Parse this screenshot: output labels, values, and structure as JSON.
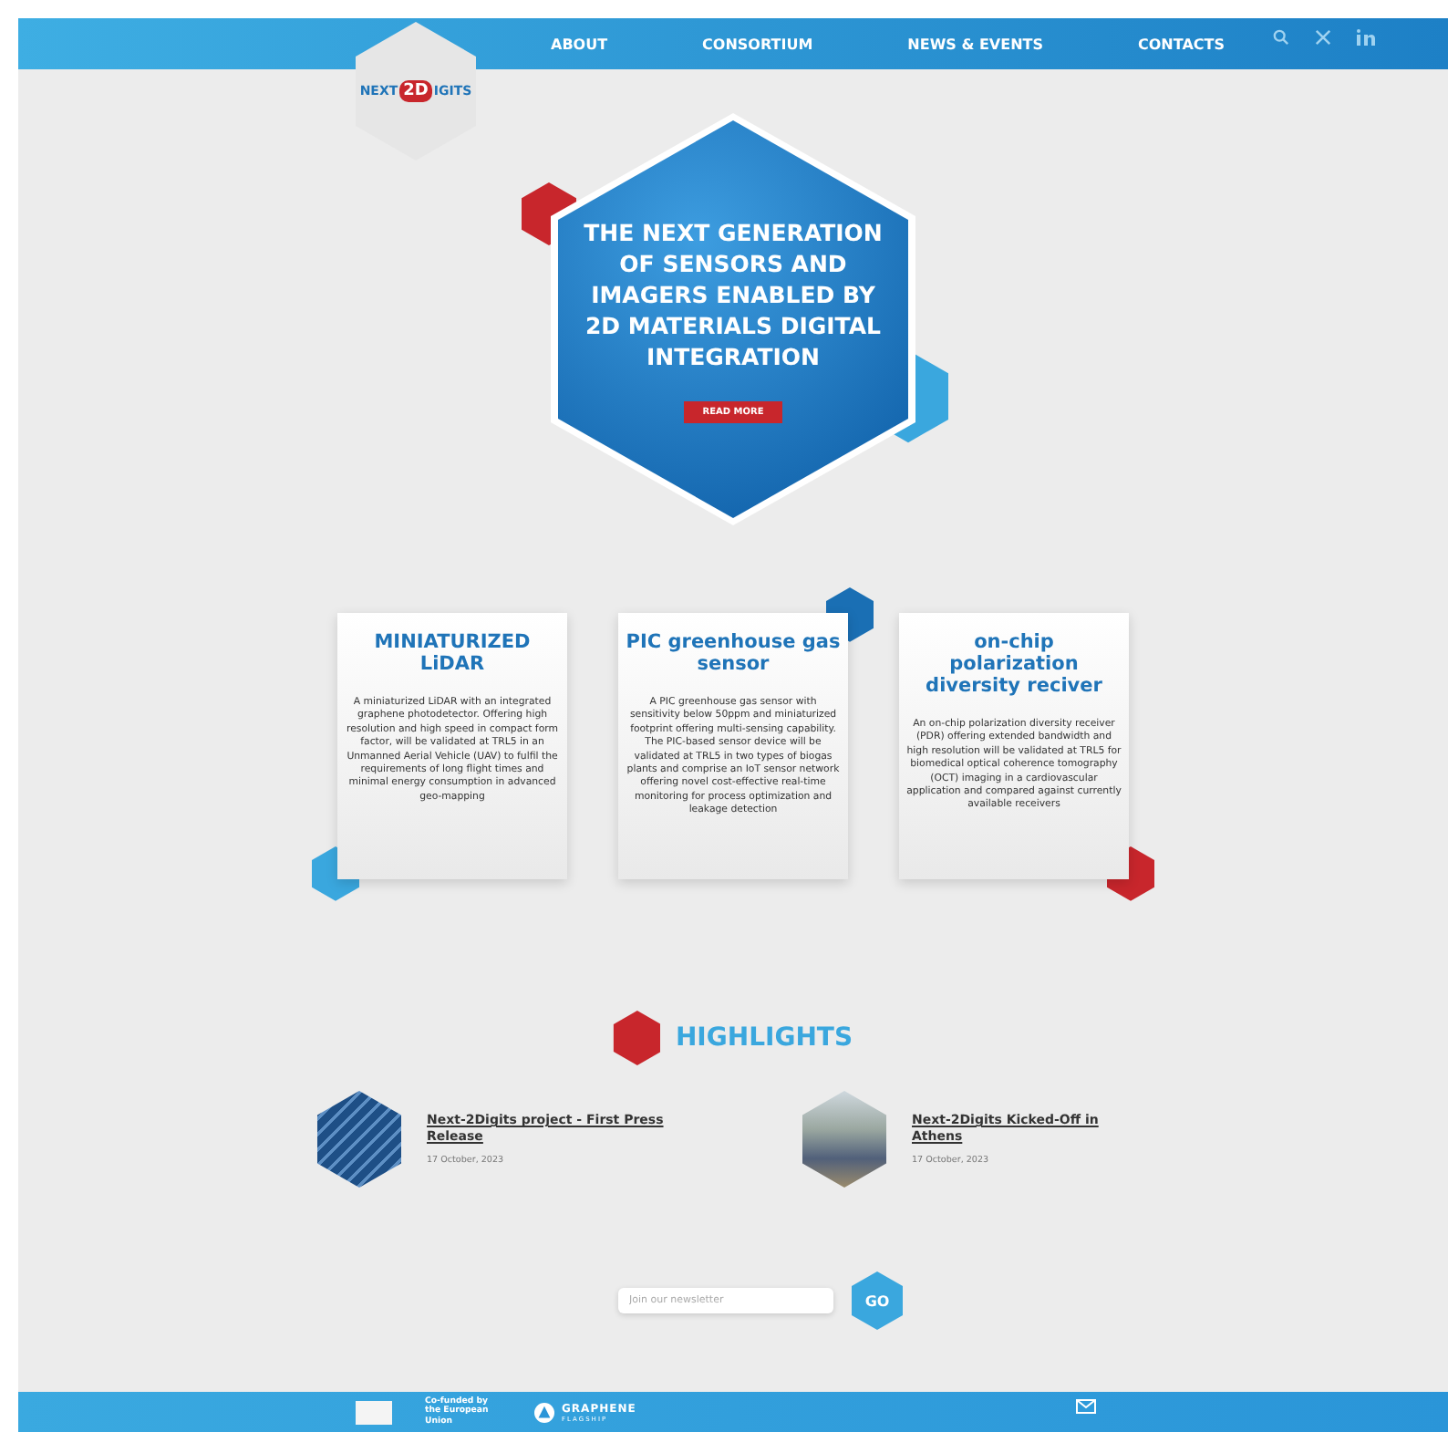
{
  "header": {
    "logo": {
      "word": "NEXT",
      "mark": "2D",
      "tail": "IGITS"
    },
    "nav": [
      {
        "label": "ABOUT"
      },
      {
        "label": "CONSORTIUM"
      },
      {
        "label": "NEWS & EVENTS"
      },
      {
        "label": "CONTACTS"
      }
    ]
  },
  "hero": {
    "title": "THE NEXT GENERATION OF SENSORS AND IMAGERS ENABLED BY 2D MATERIALS DIGITAL INTEGRATION",
    "button": "READ MORE"
  },
  "cards": [
    {
      "title": "MINIATURIZED LiDAR",
      "text": "A miniaturized LiDAR with an integrated graphene photodetector. Offering high resolution and high speed in compact form factor, will be validated at TRL5 in an Unmanned Aerial Vehicle (UAV) to fulfil the requirements of long flight times and minimal energy consumption in advanced geo-mapping"
    },
    {
      "title": "PIC greenhouse gas sensor",
      "text": "A PIC greenhouse gas sensor with sensitivity below 50ppm and miniaturized footprint offering multi-sensing capability. The PIC-based sensor device will be validated at TRL5 in two types of biogas plants and comprise an IoT sensor network offering novel cost-effective real-time monitoring for process optimization and leakage detection"
    },
    {
      "title": "on-chip polarization diversity reciver",
      "text": "An on-chip polarization diversity receiver (PDR) offering extended bandwidth and high resolution will be validated at TRL5 for biomedical optical coherence tomography (OCT) imaging in a cardiovascular application and compared against currently available receivers"
    }
  ],
  "highlights": {
    "title": "HIGHLIGHTS",
    "items": [
      {
        "kind": "material",
        "title": "Next-2Digits project - First Press Release",
        "date": "17 October, 2023"
      },
      {
        "kind": "photo",
        "title": "Next-2Digits Kicked-Off in Athens",
        "date": "17 October, 2023"
      }
    ]
  },
  "newsletter": {
    "placeholder": "Join our newsletter",
    "button": "GO"
  },
  "footer": {
    "eu_text": "Co-funded by the European Union",
    "graphene": "GRAPHENE",
    "flagship": "FLAGSHIP"
  }
}
